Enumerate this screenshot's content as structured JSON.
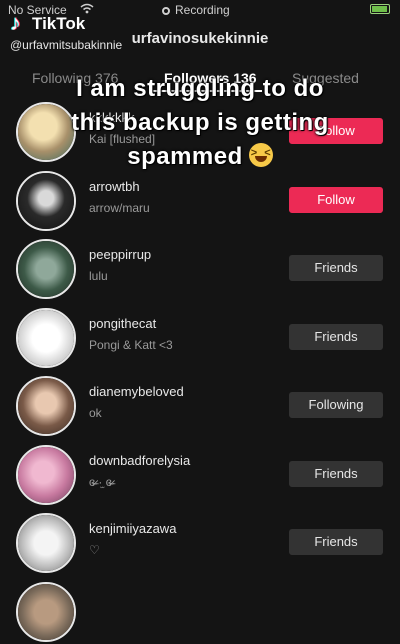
{
  "status_bar": {
    "carrier": "No Service",
    "recording_label": "Recording"
  },
  "watermark": {
    "brand": "TikTok",
    "username": "@urfavmitsubakinnie"
  },
  "profile_name": "urfavinosukekinnie",
  "tabs": [
    {
      "label": "Following 376",
      "active": false
    },
    {
      "label": "Followers 136",
      "active": true
    },
    {
      "label": "Suggested",
      "active": false
    }
  ],
  "overlay": {
    "line1": "I am struggling to do",
    "line2": "this backup is getting",
    "line3": "spammed"
  },
  "rows": [
    {
      "username": "kkkkkkk",
      "subname": "Kai [flushed]",
      "button": "Follow",
      "button_type": "follow",
      "avatar_color": "#c9b89a"
    },
    {
      "username": "arrowtbh",
      "subname": "arrow/maru",
      "button": "Follow",
      "button_type": "follow",
      "avatar_color": "#3a3a3a"
    },
    {
      "username": "peeppirrup",
      "subname": "lulu",
      "button": "Friends",
      "button_type": "friends",
      "avatar_color": "#3f5a4a"
    },
    {
      "username": "pongithecat",
      "subname": "Pongi & Katt <3",
      "button": "Friends",
      "button_type": "friends",
      "avatar_color": "#d8d8d8"
    },
    {
      "username": "dianemybeloved",
      "subname": "ok",
      "button": "Following",
      "button_type": "following",
      "avatar_color": "#6a5448"
    },
    {
      "username": "downbadforelysia",
      "subname": "ɞ̴̶̷ ·̫ ɞ̴̶̷",
      "button": "Friends",
      "button_type": "friends",
      "avatar_color": "#c87aa0"
    },
    {
      "username": "kenjimiiyazawa",
      "subname": "♡",
      "button": "Friends",
      "button_type": "friends",
      "avatar_color": "#c8c8c8"
    },
    {
      "username": "",
      "subname": "",
      "button": "",
      "button_type": "none",
      "avatar_color": "#7a6a5a"
    }
  ],
  "colors": {
    "follow_button": "#ec2a55",
    "friends_button": "#333333"
  }
}
